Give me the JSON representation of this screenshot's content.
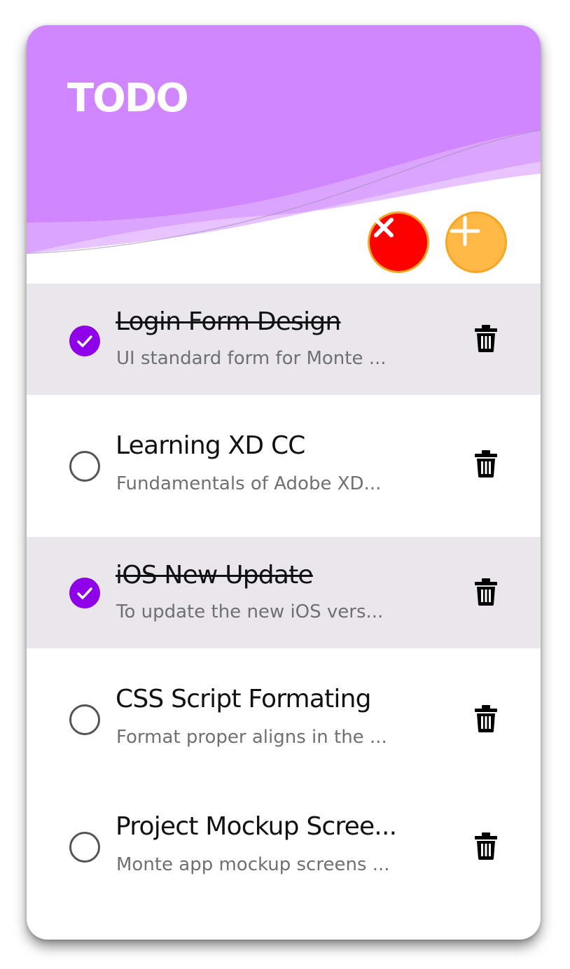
{
  "app": {
    "title": "TODO",
    "accent_color": "#8e00e8",
    "header_color": "#cf86ff"
  },
  "actions": {
    "clear_icon": "close-icon",
    "clear_color": "#ff0000",
    "add_icon": "plus-icon",
    "add_color": "#ffb846"
  },
  "todos": [
    {
      "title": "Login Form Design",
      "description": "UI standard form for Monte ...",
      "completed": true
    },
    {
      "title": "Learning XD CC",
      "description": "Fundamentals of Adobe XD...",
      "completed": false
    },
    {
      "title": "iOS New Update",
      "description": "To update the new iOS vers...",
      "completed": true
    },
    {
      "title": "CSS Script Formating",
      "description": "Format proper aligns in the ...",
      "completed": false
    },
    {
      "title": "Project Mockup Scree...",
      "description": "Monte app mockup screens ...",
      "completed": false
    }
  ],
  "icons": {
    "delete": "trash-icon",
    "checked": "check-circle-icon",
    "unchecked": "empty-circle-icon"
  }
}
